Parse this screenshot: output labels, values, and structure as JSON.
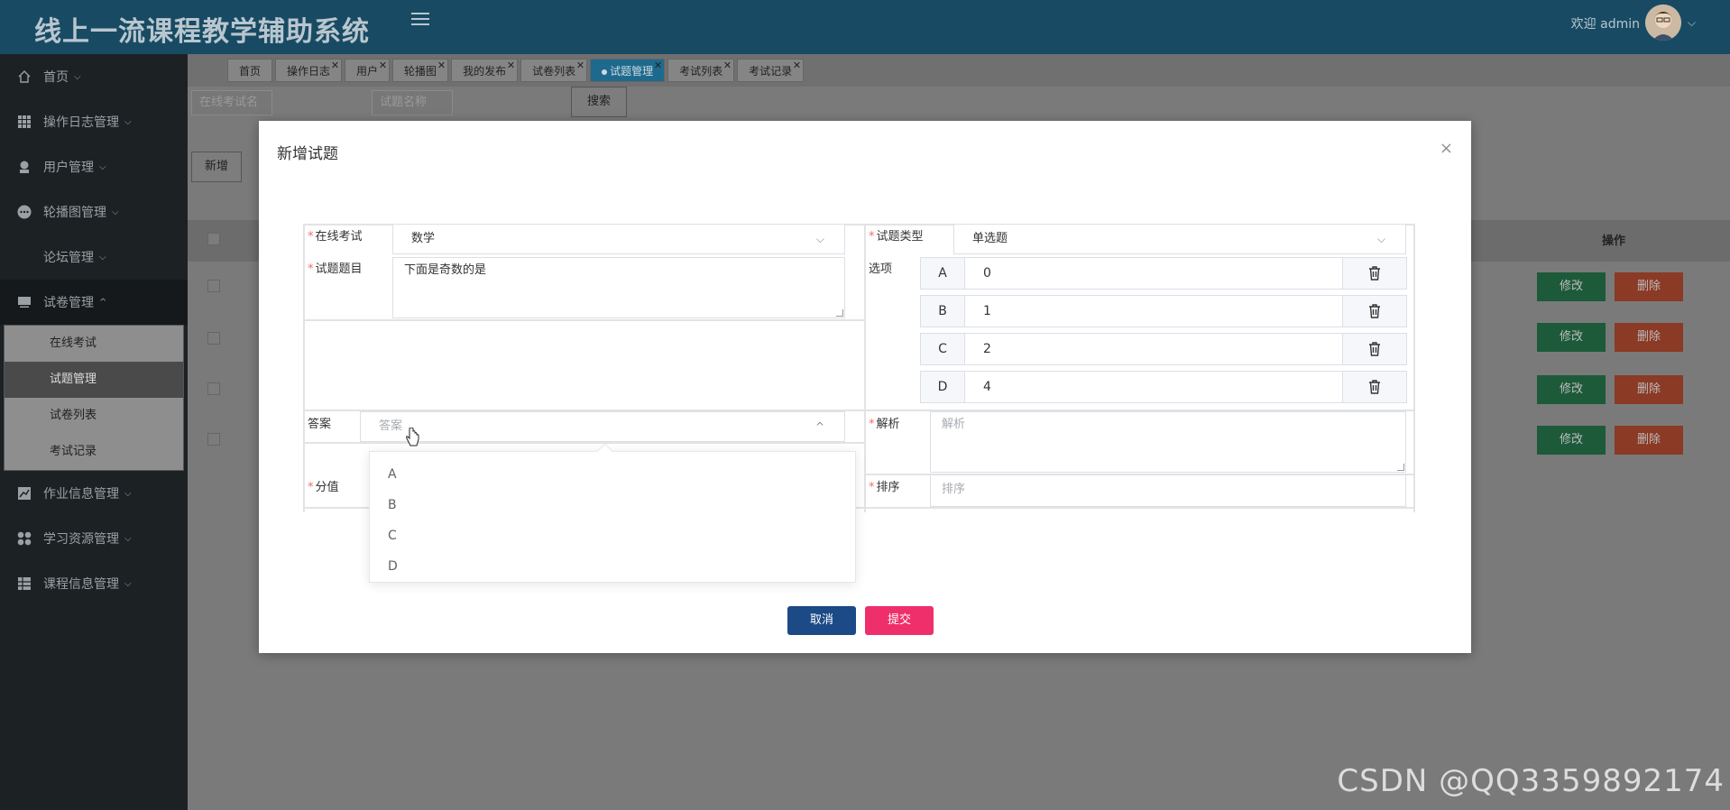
{
  "header": {
    "title": "线上一流课程教学辅助系统",
    "welcome": "欢迎 admin"
  },
  "sidebar": {
    "items": [
      {
        "label": "首页",
        "icon": "home-icon"
      },
      {
        "label": "操作日志管理",
        "icon": "grid-icon"
      },
      {
        "label": "用户管理",
        "icon": "user-icon"
      },
      {
        "label": "轮播图管理",
        "icon": "dots-icon"
      },
      {
        "label": "论坛管理",
        "icon": ""
      },
      {
        "label": "试卷管理",
        "icon": "monitor-icon"
      }
    ],
    "submenu": [
      "在线考试",
      "试题管理",
      "试卷列表",
      "考试记录"
    ],
    "items_after": [
      {
        "label": "作业信息管理",
        "icon": "chart-icon"
      },
      {
        "label": "学习资源管理",
        "icon": "apps-icon"
      },
      {
        "label": "课程信息管理",
        "icon": "table-icon"
      }
    ]
  },
  "tabs": [
    "首页",
    "操作日志",
    "用户",
    "轮播图",
    "我的发布",
    "试卷列表",
    "试题管理",
    "考试列表",
    "考试记录"
  ],
  "background": {
    "search_exam_placeholder": "在线考试名",
    "search_question_placeholder": "试题名称",
    "search_button": "搜索",
    "add_button": "新增",
    "op_header": "操作",
    "edit_label": "修改",
    "delete_label": "删除"
  },
  "modal": {
    "title": "新增试题",
    "close": "×",
    "exam_label": "在线考试",
    "exam_value": "数学",
    "type_label": "试题类型",
    "type_value": "单选题",
    "question_label": "试题题目",
    "question_value": "下面是奇数的是",
    "options_label": "选项",
    "options": [
      {
        "letter": "A",
        "value": "0"
      },
      {
        "letter": "B",
        "value": "1"
      },
      {
        "letter": "C",
        "value": "2"
      },
      {
        "letter": "D",
        "value": "4"
      }
    ],
    "answer_label": "答案",
    "answer_placeholder": "答案",
    "analysis_label": "解析",
    "analysis_placeholder": "解析",
    "score_label": "分值",
    "sort_label": "排序",
    "sort_placeholder": "排序",
    "answer_dropdown": [
      "A",
      "B",
      "C",
      "D"
    ],
    "cancel": "取消",
    "submit": "提交"
  },
  "watermark": "CSDN @QQ3359892174",
  "colors": {
    "header_bg": "#184b63",
    "sidebar_bg": "#1c2124",
    "cancel_bg": "#1b4a86",
    "submit_bg": "#ee2f6b",
    "required": "#f56c6c"
  }
}
